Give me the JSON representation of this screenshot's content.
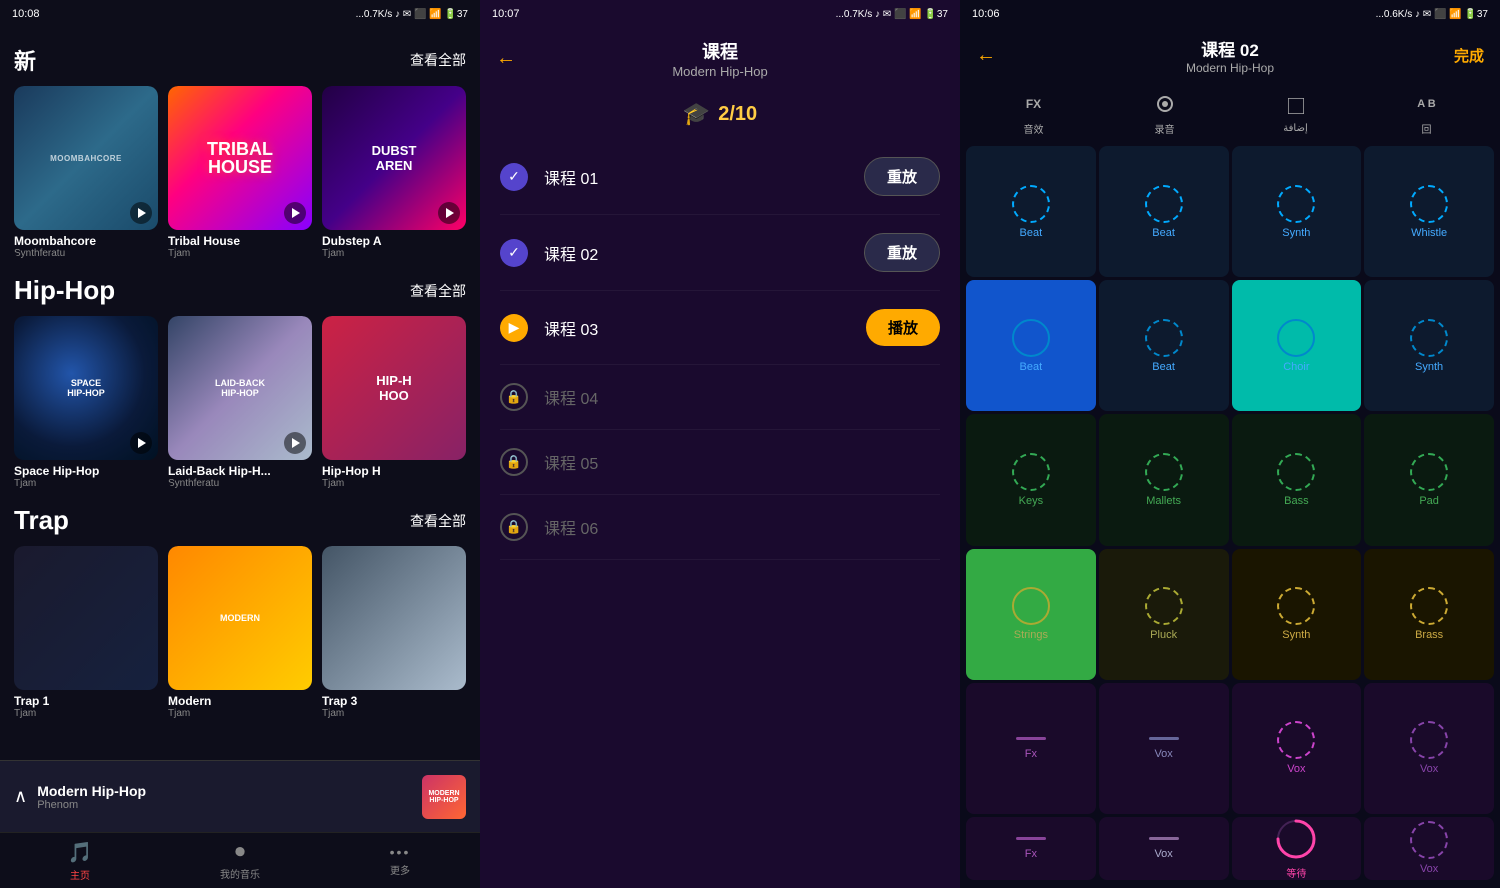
{
  "panel1": {
    "status_time": "10:08",
    "status_signal": "...0.7K/s",
    "section_new": "新",
    "see_all_1": "查看全部",
    "section_hiphop": "Hip-Hop",
    "see_all_2": "查看全部",
    "section_trap": "Trap",
    "see_all_3": "查看全部",
    "cards_new": [
      {
        "name": "Moombahcore",
        "author": "Synthferatu",
        "type": "moombahcore"
      },
      {
        "name": "Tribal House",
        "author": "Tjam",
        "type": "tribal-house"
      },
      {
        "name": "Dubstep A",
        "author": "Tjam",
        "type": "dubstep"
      }
    ],
    "cards_hiphop": [
      {
        "name": "Space Hip-Hop",
        "author": "Tjam",
        "type": "space-hiphop"
      },
      {
        "name": "Laid-Back Hip-H...",
        "author": "Synthferatu",
        "type": "laidback-hiphop"
      },
      {
        "name": "Hip-Hop H",
        "author": "Tjam",
        "type": "hiphop-h"
      }
    ],
    "cards_trap": [
      {
        "name": "Trap 1",
        "author": "Tjam",
        "type": "trap1"
      },
      {
        "name": "Modern",
        "author": "Tjam",
        "type": "trap2"
      },
      {
        "name": "Trap 3",
        "author": "Tjam",
        "type": "trap3"
      }
    ],
    "bottom_bar": {
      "title": "Modern Hip-Hop",
      "artist": "Phenom"
    },
    "nav": [
      {
        "label": "主页",
        "icon": "🎵",
        "active": true
      },
      {
        "label": "我的音乐",
        "icon": "⏺",
        "active": false
      },
      {
        "label": "更多",
        "icon": "•••",
        "active": false
      }
    ]
  },
  "panel2": {
    "status_time": "10:07",
    "title": "课程",
    "subtitle": "Modern Hip-Hop",
    "progress": "2/10",
    "back_icon": "←",
    "lessons": [
      {
        "name": "课程 01",
        "status": "done",
        "btn_label": "重放",
        "btn_type": "replay"
      },
      {
        "name": "课程 02",
        "status": "done",
        "btn_label": "重放",
        "btn_type": "replay"
      },
      {
        "name": "课程 03",
        "status": "current",
        "btn_label": "播放",
        "btn_type": "play"
      },
      {
        "name": "课程 04",
        "status": "locked",
        "btn_label": "",
        "btn_type": "none"
      },
      {
        "name": "课程 05",
        "status": "locked",
        "btn_label": "",
        "btn_type": "none"
      },
      {
        "name": "课程 06",
        "status": "locked",
        "btn_label": "",
        "btn_type": "none"
      }
    ]
  },
  "panel3": {
    "status_time": "10:06",
    "title": "课程 02",
    "subtitle": "Modern Hip-Hop",
    "done_label": "完成",
    "back_icon": "←",
    "toolbar": [
      {
        "label": "音效",
        "icon": "FX"
      },
      {
        "label": "录音",
        "icon": "⏺"
      },
      {
        "label": "إضافة",
        "icon": "□"
      },
      {
        "label": "回",
        "icon": "AB"
      }
    ],
    "pads": [
      {
        "name": "Beat",
        "row": 1,
        "active": false
      },
      {
        "name": "Beat",
        "row": 1,
        "active": false
      },
      {
        "name": "Synth",
        "row": 1,
        "active": false
      },
      {
        "name": "Whistle",
        "row": 1,
        "active": false
      },
      {
        "name": "Beat",
        "row": 2,
        "active": true,
        "color": "blue"
      },
      {
        "name": "Beat",
        "row": 2,
        "active": false
      },
      {
        "name": "Choir",
        "row": 2,
        "active": true,
        "color": "cyan"
      },
      {
        "name": "Synth",
        "row": 2,
        "active": false
      },
      {
        "name": "Keys",
        "row": 3,
        "active": false
      },
      {
        "name": "Mallets",
        "row": 3,
        "active": false
      },
      {
        "name": "Bass",
        "row": 3,
        "active": false
      },
      {
        "name": "Pad",
        "row": 3,
        "active": false
      },
      {
        "name": "Strings",
        "row": 4,
        "active": true,
        "color": "green"
      },
      {
        "name": "Pluck",
        "row": 4,
        "active": false
      },
      {
        "name": "Synth",
        "row": 4,
        "active": false
      },
      {
        "name": "Brass",
        "row": 4,
        "active": false
      },
      {
        "name": "Fx",
        "row": 5,
        "type": "line",
        "line_color": "#884499"
      },
      {
        "name": "Vox",
        "row": 5,
        "type": "line",
        "line_color": "#666699"
      },
      {
        "name": "Vox",
        "row": 5,
        "type": "ring_purple"
      },
      {
        "name": "Vox",
        "row": 5,
        "type": "ring_purple2"
      },
      {
        "name": "Fx",
        "row": 6,
        "type": "line2",
        "line_color": "#884499"
      },
      {
        "name": "Vox",
        "row": 6,
        "type": "line2",
        "line_color": "#886699"
      },
      {
        "name": "",
        "row": 6,
        "type": "waiting"
      },
      {
        "name": "Vox",
        "row": 6,
        "type": "ring_purple3"
      }
    ]
  }
}
